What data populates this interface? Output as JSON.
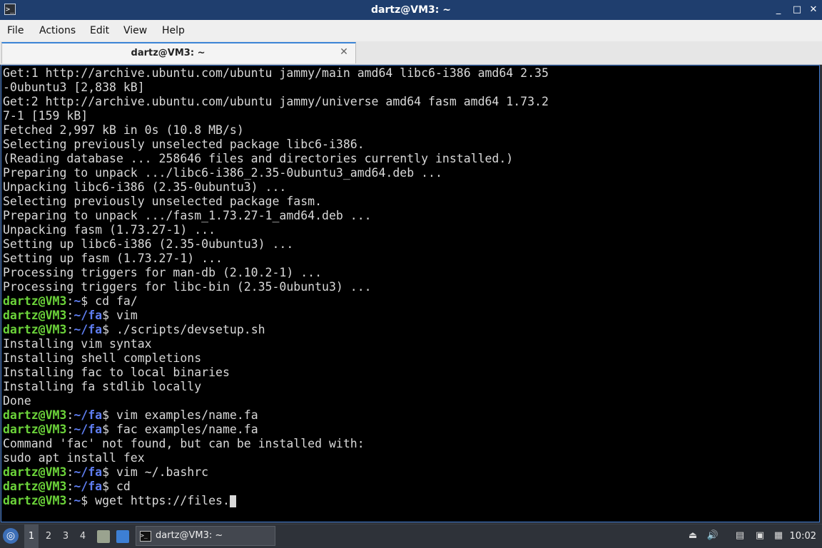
{
  "window": {
    "title": "dartz@VM3: ~",
    "minimize": "_",
    "maximize": "□",
    "close": "✕"
  },
  "menu": [
    "File",
    "Actions",
    "Edit",
    "View",
    "Help"
  ],
  "tab": {
    "label": "dartz@VM3: ~",
    "close": "✕"
  },
  "terminal": {
    "lines": [
      {
        "out": "Get:1 http://archive.ubuntu.com/ubuntu jammy/main amd64 libc6-i386 amd64 2.35"
      },
      {
        "out": "-0ubuntu3 [2,838 kB]"
      },
      {
        "out": "Get:2 http://archive.ubuntu.com/ubuntu jammy/universe amd64 fasm amd64 1.73.2"
      },
      {
        "out": "7-1 [159 kB]"
      },
      {
        "out": "Fetched 2,997 kB in 0s (10.8 MB/s)"
      },
      {
        "out": "Selecting previously unselected package libc6-i386."
      },
      {
        "out": "(Reading database ... 258646 files and directories currently installed.)"
      },
      {
        "out": "Preparing to unpack .../libc6-i386_2.35-0ubuntu3_amd64.deb ..."
      },
      {
        "out": "Unpacking libc6-i386 (2.35-0ubuntu3) ..."
      },
      {
        "out": "Selecting previously unselected package fasm."
      },
      {
        "out": "Preparing to unpack .../fasm_1.73.27-1_amd64.deb ..."
      },
      {
        "out": "Unpacking fasm (1.73.27-1) ..."
      },
      {
        "out": "Setting up libc6-i386 (2.35-0ubuntu3) ..."
      },
      {
        "out": "Setting up fasm (1.73.27-1) ..."
      },
      {
        "out": "Processing triggers for man-db (2.10.2-1) ..."
      },
      {
        "out": "Processing triggers for libc-bin (2.35-0ubuntu3) ..."
      },
      {
        "prompt": [
          "dartz@VM3",
          ":",
          "~",
          "$"
        ],
        "cmd": " cd fa/"
      },
      {
        "prompt": [
          "dartz@VM3",
          ":",
          "~/fa",
          "$"
        ],
        "cmd": " vim"
      },
      {
        "prompt": [
          "dartz@VM3",
          ":",
          "~/fa",
          "$"
        ],
        "cmd": " ./scripts/devsetup.sh"
      },
      {
        "out": "Installing vim syntax"
      },
      {
        "out": "Installing shell completions"
      },
      {
        "out": "Installing fac to local binaries"
      },
      {
        "out": "Installing fa stdlib locally"
      },
      {
        "out": "Done"
      },
      {
        "prompt": [
          "dartz@VM3",
          ":",
          "~/fa",
          "$"
        ],
        "cmd": " vim examples/name.fa"
      },
      {
        "prompt": [
          "dartz@VM3",
          ":",
          "~/fa",
          "$"
        ],
        "cmd": " fac examples/name.fa"
      },
      {
        "out": "Command 'fac' not found, but can be installed with:"
      },
      {
        "out": "sudo apt install fex"
      },
      {
        "prompt": [
          "dartz@VM3",
          ":",
          "~/fa",
          "$"
        ],
        "cmd": " vim ~/.bashrc"
      },
      {
        "prompt": [
          "dartz@VM3",
          ":",
          "~/fa",
          "$"
        ],
        "cmd": " cd"
      },
      {
        "prompt": [
          "dartz@VM3",
          ":",
          "~",
          "$"
        ],
        "cmd": " wget https://files.",
        "cursor": true
      }
    ]
  },
  "taskbar": {
    "desktops": [
      "1",
      "2",
      "3",
      "4"
    ],
    "task_label": "dartz@VM3: ~",
    "clock": "10:02",
    "tray": [
      "volume-icon",
      "battery-icon",
      "network-icon",
      "notifications-icon"
    ]
  },
  "colors": {
    "user": "#6cd43a",
    "path": "#5f7ef2",
    "titlebar": "#1f3e6e",
    "terminal_bg": "#000000"
  }
}
